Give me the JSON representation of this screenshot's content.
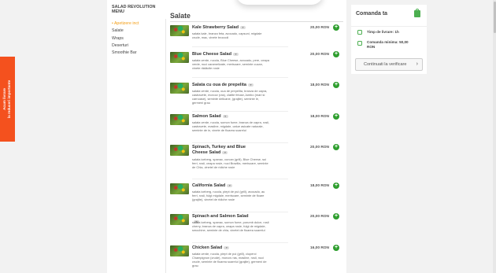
{
  "promo": {
    "line1": "Acum livrare",
    "line2": "la reduceri importante"
  },
  "menu": {
    "title": "SALAD REVOLUTION MENU",
    "categories": [
      {
        "label": "• Apetizere inct",
        "active": true
      },
      {
        "label": "Salate",
        "active": false
      },
      {
        "label": "Wraps",
        "active": false
      },
      {
        "label": "Deserturi",
        "active": false
      },
      {
        "label": "Smoothie Bar",
        "active": false
      }
    ]
  },
  "section": {
    "title": "Salate"
  },
  "items": [
    {
      "name": "Kale Strawberry Salad",
      "desc": "salata kale, branza feta, avocado, capsuni, migdale crude, mac, vinete broccoli",
      "price": "20,00 RON"
    },
    {
      "name": "Blue Cheese Salad",
      "desc": "salata verde, rucola, Blue Cheese, avocado, pere, ceapa verde, nuci caramelizate, merisoare, seminte cucan, vinete rădăcite rosie",
      "price": "20,00 RON"
    },
    {
      "name": "Salata cu oua de prepelita",
      "desc": "salata verde, rucola, oua de prepelita, branza de capra, castravete, morcov (ras), clatite feluse,Jumbo (mari si carnoase), seminte delicane, (grajite), seminte le, germeni grau",
      "price": "18,00 RON"
    },
    {
      "name": "Salmon Salad",
      "desc": "salata verde, rucola, somon fume, branza de capra, rosii, castravete, masline, migdale, catue asicate naturale, seminte de in, vinete de floarea soarelui",
      "price": "18,00 RON"
    },
    {
      "name": "Spinach, Turkey and Blue Cheese Salad",
      "desc": "salata iceberg, spanac, curcan (grill), Blue Cheese, sui ferri, rosii, ceapa rosie, nuci Brazilia, merisoare, seminte de Chia, vinetel de ridiche rosie",
      "price": "20,00 RON"
    },
    {
      "name": "California Salad",
      "desc": "salata iceberg, rucola, piept de pui (grill), avocado, au ferri, rosii, fulgi migdale, merisoare, seminte de floare (grajite), vinetel de ridiche rosie",
      "price": "18,00 RON"
    },
    {
      "name": "Spinach and Salmon Salad",
      "desc": "salata iceberg, spanac, somon fume, porumb dulce, rosii cherry, branza de capra, ceapa rosie, fulgi de migdale, smochine, seminte de chia, vinetel de floarea soarelui",
      "price": "20,00 RON"
    },
    {
      "name": "Chicken Salad",
      "desc": "salata verde, rucola, piept de pui (grill), ciuperci Champignon (crude), morcov ras, masline, rosii, nuci crude, seminte de floarea soarelui (grajite), germeni de grau",
      "price": "16,00 RON"
    }
  ],
  "cart": {
    "title": "Comanda ta",
    "delivery_label": "Timp de livrare: 1h",
    "min_label": "Comanda minima: 50,00",
    "min_currency": "RON",
    "button": "Continuati la verificare"
  }
}
